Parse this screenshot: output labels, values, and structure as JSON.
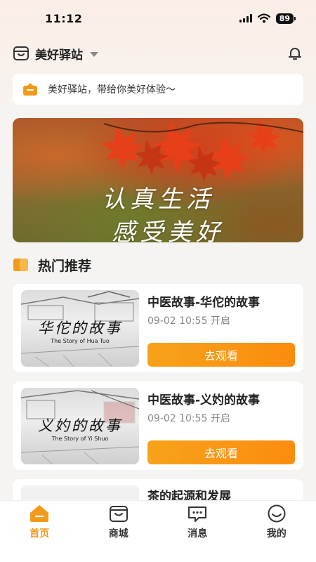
{
  "status_bar": {
    "time": "11:12",
    "battery": "89"
  },
  "header": {
    "station_name": "美好驿站"
  },
  "notice": {
    "text": "美好驿站，带给你美好体验～"
  },
  "banner": {
    "line1": "认真生活",
    "line2": "感受美好"
  },
  "section": {
    "title": "热门推荐"
  },
  "cards": [
    {
      "thumb_caption": "华佗的故事",
      "thumb_sub": "The Story of Hua Tuo",
      "title": "中医故事-华佗的故事",
      "time": "09-02 10:55 开启",
      "button": "去观看"
    },
    {
      "thumb_caption": "义妁的故事",
      "thumb_sub": "The Story of Yi Shuo",
      "title": "中医故事-义妁的故事",
      "time": "09-02 10:55 开启",
      "button": "去观看"
    },
    {
      "title": "茶的起源和发展"
    }
  ],
  "tabbar": [
    {
      "label": "首页",
      "icon": "home-icon",
      "active": true
    },
    {
      "label": "商城",
      "icon": "shop-icon",
      "active": false
    },
    {
      "label": "消息",
      "icon": "message-icon",
      "active": false
    },
    {
      "label": "我的",
      "icon": "profile-icon",
      "active": false
    }
  ],
  "colors": {
    "accent": "#f39a1a",
    "button": "#fb8c0e"
  }
}
